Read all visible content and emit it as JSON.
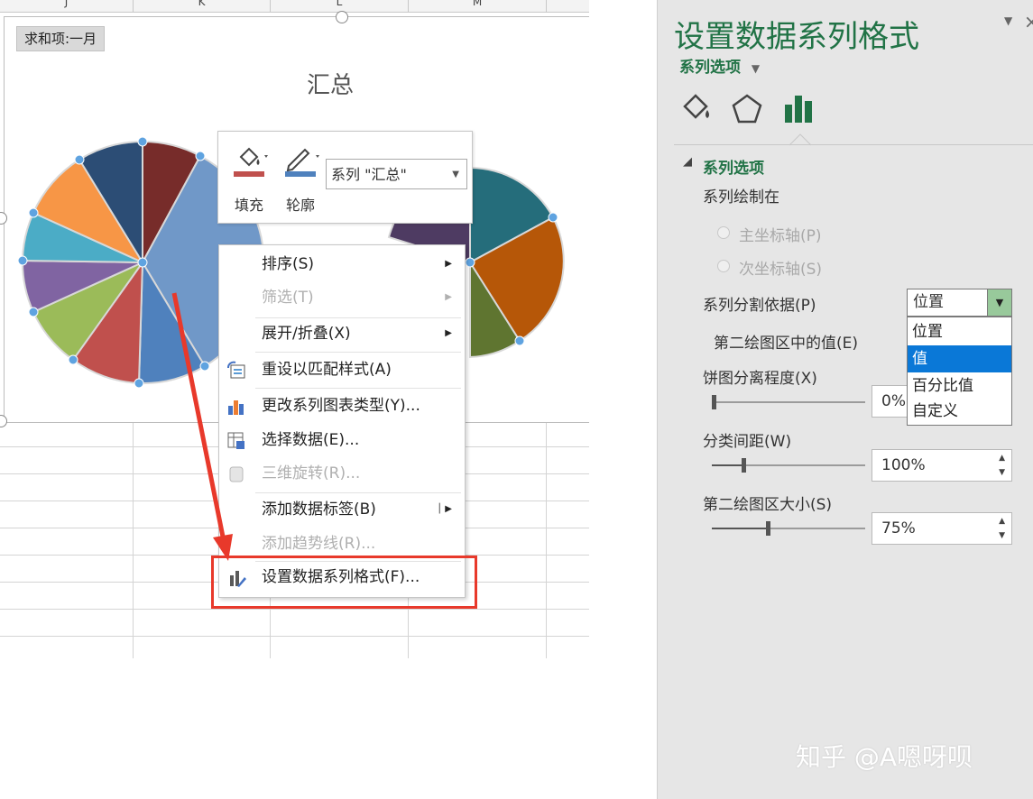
{
  "sheet": {
    "columns": [
      "J",
      "K",
      "L",
      "M"
    ],
    "pivot_field_button": "求和项:一月",
    "chart_title": "汇总"
  },
  "mini_toolbar": {
    "fill_label": "填充",
    "outline_label": "轮廓",
    "series_selector": "系列 \"汇总\""
  },
  "context_menu": {
    "items": [
      {
        "label": "排序(S)",
        "enabled": true,
        "submenu": true,
        "icon": ""
      },
      {
        "label": "筛选(T)",
        "enabled": false,
        "submenu": true,
        "icon": ""
      },
      {
        "label": "展开/折叠(X)",
        "enabled": true,
        "submenu": true,
        "icon": ""
      },
      {
        "label": "重设以匹配样式(A)",
        "enabled": true,
        "submenu": false,
        "icon": "reset-style-icon"
      },
      {
        "label": "更改系列图表类型(Y)...",
        "enabled": true,
        "submenu": false,
        "icon": "change-chart-type-icon"
      },
      {
        "label": "选择数据(E)...",
        "enabled": true,
        "submenu": false,
        "icon": "select-data-icon"
      },
      {
        "label": "三维旋转(R)...",
        "enabled": false,
        "submenu": false,
        "icon": "3d-rotation-icon"
      },
      {
        "label": "添加数据标签(B)",
        "enabled": true,
        "submenu": true,
        "icon": ""
      },
      {
        "label": "添加趋势线(R)...",
        "enabled": false,
        "submenu": false,
        "icon": ""
      },
      {
        "label": "设置数据系列格式(F)...",
        "enabled": true,
        "submenu": false,
        "icon": "format-series-icon"
      }
    ]
  },
  "format_pane": {
    "title": "设置数据系列格式",
    "subtitle": "系列选项",
    "section_header": "系列选项",
    "plot_series_on": "系列绘制在",
    "primary_axis": "主坐标轴(P)",
    "secondary_axis": "次坐标轴(S)",
    "split_by_label": "系列分割依据(P)",
    "split_by_value": "位置",
    "split_by_options": [
      "位置",
      "值",
      "百分比值",
      "自定义"
    ],
    "split_by_highlighted": 1,
    "second_plot_values_label": "第二绘图区中的值(E)",
    "explosion_label": "饼图分离程度(X)",
    "explosion_value": "0%",
    "gap_width_label": "分类间距(W)",
    "gap_width_value": "100%",
    "second_plot_size_label": "第二绘图区大小(S)",
    "second_plot_size_value": "75%"
  },
  "watermark": "知乎 @A嗯呀呗",
  "colors": {
    "accent_green": "#217346",
    "highlight_red": "#e8392b",
    "selection_blue": "#0a78d7"
  }
}
